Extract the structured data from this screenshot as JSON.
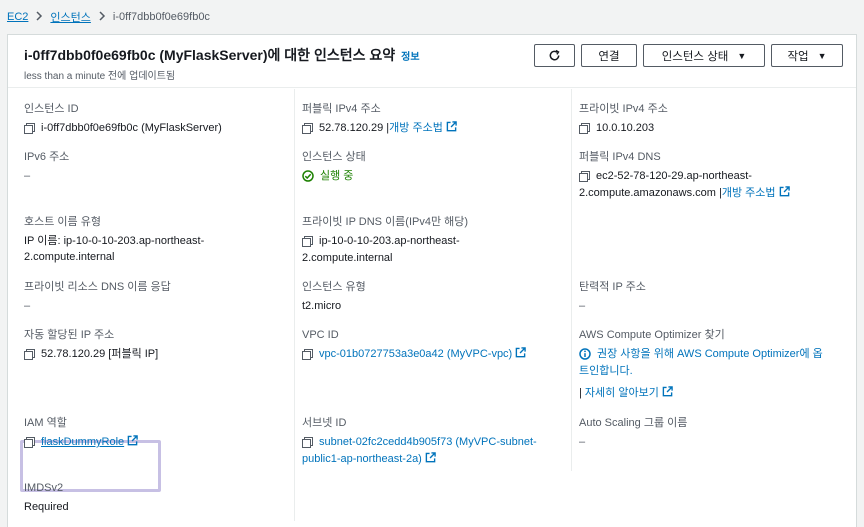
{
  "breadcrumb": {
    "root": "EC2",
    "section": "인스턴스",
    "current": "i-0ff7dbb0f0e69fb0c"
  },
  "header": {
    "title": "i-0ff7dbb0f0e69fb0c (MyFlaskServer)에 대한 인스턴스 요약",
    "info_link": "정보",
    "updated": "less than a minute 전에 업데이트됨",
    "connect_label": "연결",
    "instance_state_label": "인스턴스 상태",
    "actions_label": "작업"
  },
  "fields": {
    "instance_id": {
      "label": "인스턴스 ID",
      "value": "i-0ff7dbb0f0e69fb0c (MyFlaskServer)"
    },
    "public_ipv4": {
      "label": "퍼블릭 IPv4 주소",
      "value": "52.78.120.29",
      "link": "개방 주소법"
    },
    "private_ipv4": {
      "label": "프라이빗 IPv4 주소",
      "value": "10.0.10.203"
    },
    "ipv6": {
      "label": "IPv6 주소",
      "value": "–"
    },
    "instance_state": {
      "label": "인스턴스 상태",
      "value": "실행 중"
    },
    "public_dns": {
      "label": "퍼블릭 IPv4 DNS",
      "value_line1": "ec2-52-78-120-29.ap-northeast-",
      "value_line2": "2.compute.amazonaws.com",
      "link": "개방 주소법"
    },
    "hostname_type": {
      "label": "호스트 이름 유형",
      "value_line1": "IP 이름: ip-10-0-10-203.ap-northeast-",
      "value_line2": "2.compute.internal"
    },
    "private_dns": {
      "label": "프라이빗 IP DNS 이름(IPv4만 해당)",
      "value_line1": "ip-10-0-10-203.ap-northeast-",
      "value_line2": "2.compute.internal"
    },
    "private_resource_dns": {
      "label": "프라이빗 리소스 DNS 이름 응답",
      "value": "–"
    },
    "instance_type": {
      "label": "인스턴스 유형",
      "value": "t2.micro"
    },
    "elastic_ip": {
      "label": "탄력적 IP 주소",
      "value": "–"
    },
    "auto_ip": {
      "label": "자동 할당된 IP 주소",
      "value": "52.78.120.29 [퍼블릭 IP]"
    },
    "vpc_id": {
      "label": "VPC ID",
      "value": "vpc-01b0727753a3e0a42 (MyVPC-vpc)"
    },
    "optimizer": {
      "label": "AWS Compute Optimizer 찾기",
      "message_line1": "권장 사항을 위해 AWS Compute Optimizer에 옵",
      "message_line2": "트인합니다.",
      "more_link": "자세히 알아보기"
    },
    "iam_role": {
      "label": "IAM 역할",
      "value": "flaskDummyRole"
    },
    "subnet_id": {
      "label": "서브넷 ID",
      "value_line1": "subnet-02fc2cedd4b905f73 (MyVPC-subnet-",
      "value_line2": "public1-ap-northeast-2a)"
    },
    "autoscaling": {
      "label": "Auto Scaling 그룹 이름",
      "value": "–"
    },
    "imdsv2": {
      "label": "IMDSv2",
      "value": "Required"
    }
  },
  "colors": {
    "link": "#0073bb",
    "running": "#1d8102",
    "highlight": "#c7c0e4"
  }
}
